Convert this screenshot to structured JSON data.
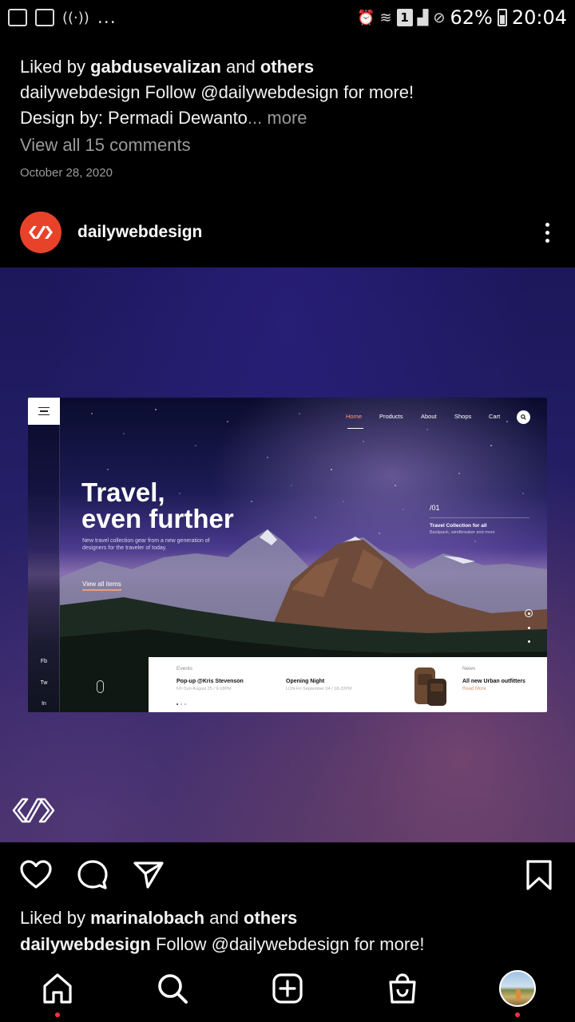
{
  "status_bar": {
    "notification_icons": [
      "gallery-icon",
      "mail-icon",
      "hotspot-icon"
    ],
    "overflow": "...",
    "sim_slot": "1",
    "battery": "62%",
    "time": "20:04"
  },
  "previous_post": {
    "liked_prefix": "Liked by ",
    "liked_user": "gabdusevalizan",
    "liked_and": " and ",
    "liked_others": "others",
    "caption_user": "dailywebdesign",
    "caption_text": " Follow @dailywebdesign for more!",
    "caption_line2": "Design by: Permadi Dewanto",
    "ellipsis": "...",
    "more_label": " more",
    "view_comments": "View all 15 comments",
    "date": "October 28, 2020"
  },
  "post": {
    "username": "dailywebdesign",
    "mockup": {
      "nav": [
        "Home",
        "Products",
        "About",
        "Shops",
        "Cart"
      ],
      "social": [
        "Fb",
        "Tw",
        "In"
      ],
      "headline_line1": "Travel,",
      "headline_line2": "even further",
      "subtext_line1": "New travel collection gear from a new generation of",
      "subtext_line2": "designers for the traveler of today.",
      "cta": "View all items",
      "index": "/01",
      "collection_title": "Travel Collection for all",
      "collection_sub": "Backpack, windbreaker and more",
      "events_label": "Events",
      "event1_title": "Pop-up @Kris Stevenson",
      "event1_sub": "NY-Sun August 25 / 9-18PM",
      "event2_title": "Opening Night",
      "event2_sub": "LON-Fri September 04 / 18-22PM",
      "news_label": "News",
      "news_title": "All new Urban outfitters",
      "news_link": "Read More"
    },
    "liked_prefix": "Liked by ",
    "liked_user": "marinalobach",
    "liked_and": " and ",
    "liked_others": "others",
    "caption_user": "dailywebdesign",
    "caption_text": " Follow @dailywebdesign for more!"
  },
  "bottom_nav": [
    "home-icon",
    "search-icon",
    "new-post-icon",
    "shop-icon",
    "profile-avatar"
  ],
  "colors": {
    "accent_red": "#ff3040",
    "avatar_bg": "#e8432a"
  }
}
